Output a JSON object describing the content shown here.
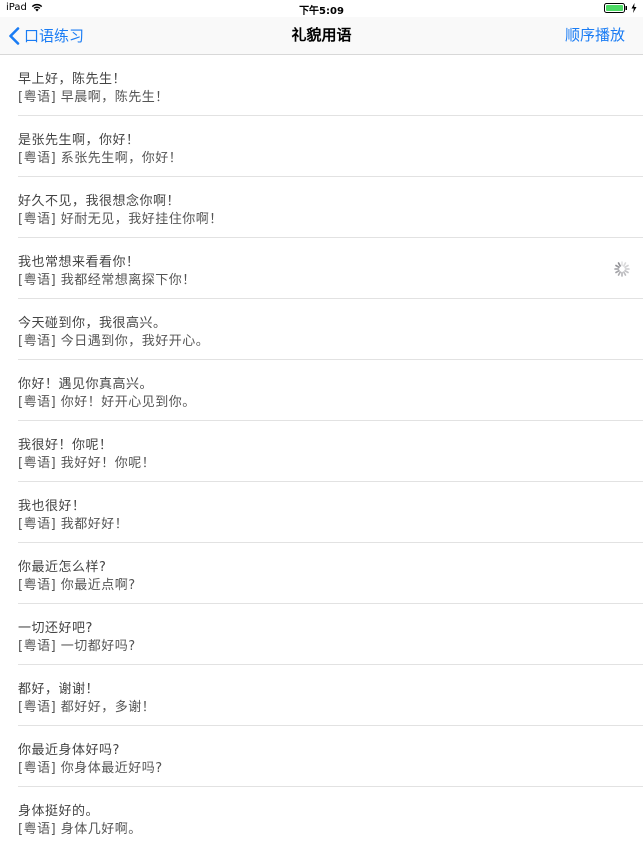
{
  "status_bar": {
    "device": "iPad",
    "time": "下午5:09"
  },
  "nav": {
    "back_label": "口语练习",
    "title": "礼貌用语",
    "action_label": "顺序播放"
  },
  "phrases": [
    {
      "primary": "早上好，陈先生！",
      "secondary": "[粤语] 早晨啊，陈先生！"
    },
    {
      "primary": "是张先生啊，你好！",
      "secondary": "[粤语] 系张先生啊，你好！"
    },
    {
      "primary": "好久不见，我很想念你啊！",
      "secondary": "[粤语] 好耐无见，我好挂住你啊！"
    },
    {
      "primary": "我也常想来看看你！",
      "secondary": "[粤语] 我都经常想离探下你！",
      "loading": true
    },
    {
      "primary": "今天碰到你，我很高兴。",
      "secondary": "[粤语] 今日遇到你，我好开心。"
    },
    {
      "primary": "你好！遇见你真高兴。",
      "secondary": "[粤语] 你好！好开心见到你。"
    },
    {
      "primary": "我很好！你呢！",
      "secondary": "[粤语] 我好好！你呢！"
    },
    {
      "primary": "我也很好！",
      "secondary": "[粤语] 我都好好！"
    },
    {
      "primary": "你最近怎么样?",
      "secondary": "[粤语] 你最近点啊?"
    },
    {
      "primary": "一切还好吧?",
      "secondary": "[粤语] 一切都好吗?"
    },
    {
      "primary": "都好，谢谢！",
      "secondary": "[粤语] 都好好，多谢！"
    },
    {
      "primary": "你最近身体好吗?",
      "secondary": "[粤语] 你身体最近好吗?"
    },
    {
      "primary": "身体挺好的。",
      "secondary": "[粤语] 身体几好啊。"
    }
  ],
  "colors": {
    "accent": "#1a7cf4",
    "battery": "#4cd964"
  }
}
